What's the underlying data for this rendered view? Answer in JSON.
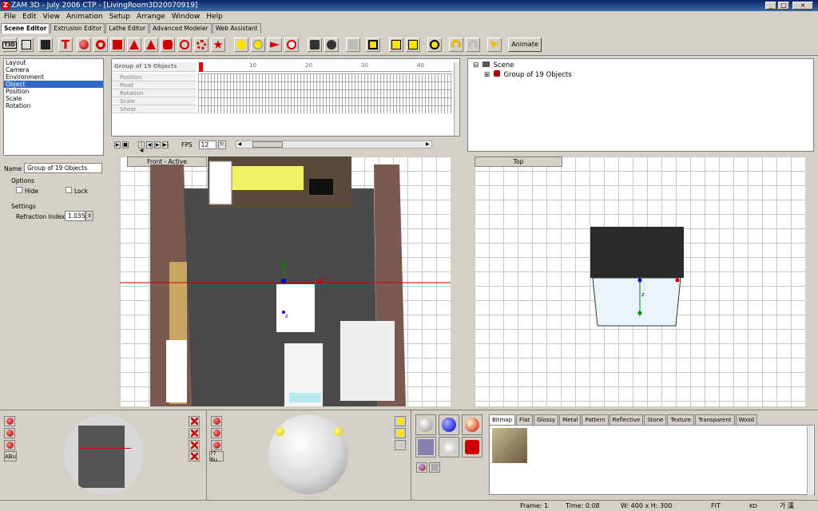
{
  "window": {
    "title": "ZAM 3D - July 2006 CTP - [LivingRoom3D20070919]"
  },
  "menu": [
    "File",
    "Edit",
    "View",
    "Animation",
    "Setup",
    "Arrange",
    "Window",
    "Help"
  ],
  "editor_tabs": [
    {
      "label": "Scene Editor",
      "active": true
    },
    {
      "label": "Extrusion Editor",
      "active": false
    },
    {
      "label": "Lathe Editor",
      "active": false
    },
    {
      "label": "Advanced Modeler",
      "active": false
    },
    {
      "label": "Web Assistant",
      "active": false
    }
  ],
  "toolbar": {
    "animate_label": "Animate",
    "text_icon_label": "T",
    "badge_label": "T3D"
  },
  "property_list": {
    "items": [
      "Layout",
      "Camera",
      "Environment",
      "Object",
      "Position",
      "Scale",
      "Rotation"
    ],
    "selected": "Object"
  },
  "timeline": {
    "title": "Group of 19 Objects",
    "rows": [
      "Position",
      "Pivot",
      "Rotation",
      "Scale",
      "Shear"
    ],
    "ticks": [
      "10",
      "20",
      "30",
      "40"
    ],
    "fps_label": "FPS",
    "fps_value": "12"
  },
  "scene_tree": {
    "root": "Scene",
    "child": "Group of 19 Objects",
    "expand_root": "⊟",
    "expand_child": "⊞"
  },
  "object_props": {
    "name_label": "Name",
    "name_value": "Group of 19 Objects",
    "options_label": "Options",
    "hide_label": "Hide",
    "lock_label": "Lock",
    "settings_label": "Settings",
    "refraction_label": "Refraction Index",
    "refraction_value": "1.035"
  },
  "viewports": {
    "front_label": "Front - Active",
    "top_label": "Top",
    "axis_x": "x",
    "axis_y": "y",
    "axis_z": "z"
  },
  "bottom_left": {
    "btn1_label": "ABu",
    "btn2_label": "??Bu"
  },
  "material_tabs": [
    "Bitmap",
    "Flat",
    "Glossy",
    "Metal",
    "Pattern",
    "Reflective",
    "Stone",
    "Texture",
    "Transparent",
    "Wood"
  ],
  "status": {
    "frame": "Frame: 1",
    "time": "Time: 0.08",
    "size": "W: 400 x H: 300",
    "fit": "FIT",
    "ime": "KO",
    "ime_chars": "가 漢"
  },
  "colors": {
    "title_bar": "#0a246a",
    "selection": "#316ac5",
    "toolbar_red": "#c00000"
  }
}
